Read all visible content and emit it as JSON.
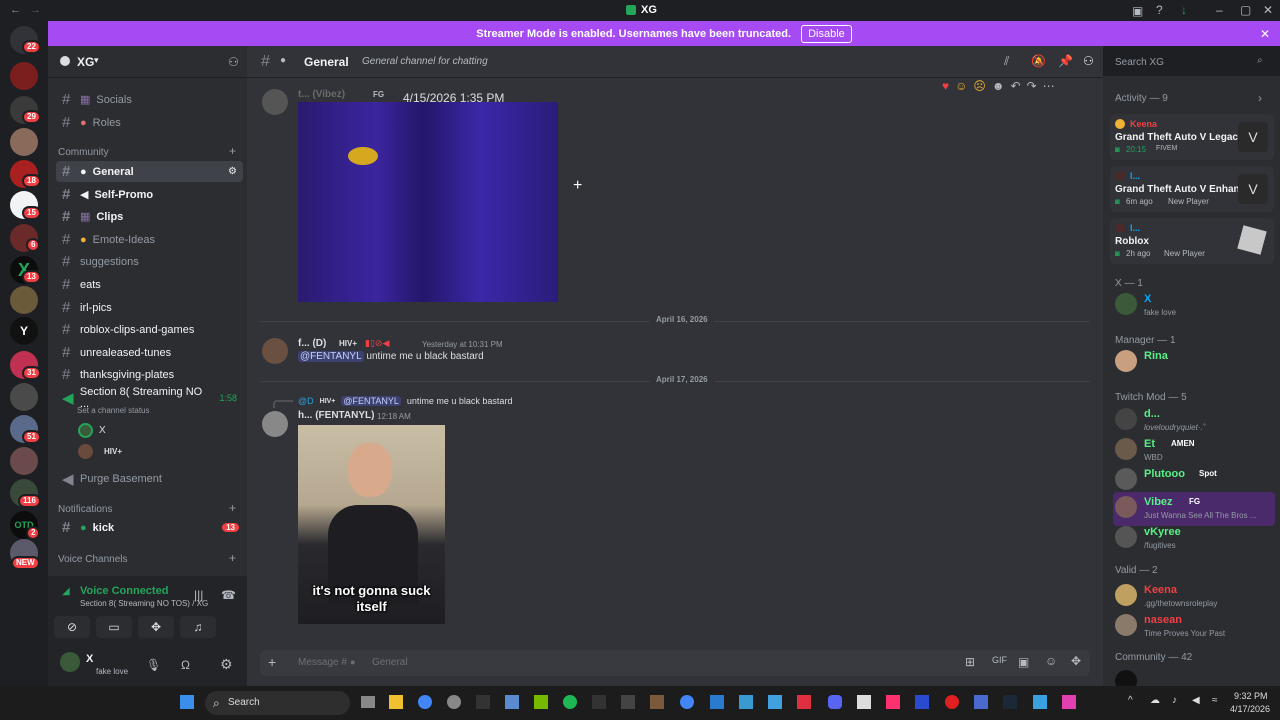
{
  "window": {
    "title": "XG"
  },
  "banner": {
    "text": "Streamer Mode is enabled. Usernames have been truncated.",
    "disable": "Disable"
  },
  "server_badges": [
    "22",
    "29",
    "18",
    "15",
    "6",
    "13",
    "31",
    "51",
    "116",
    "2"
  ],
  "new_badge": "NEW",
  "server": {
    "name": "XG"
  },
  "channels": {
    "c1": "Socials",
    "c2": "Roles",
    "community_cat": "Community",
    "general": "General",
    "selfpromo": "Self-Promo",
    "clips": "Clips",
    "emote": "Emote-Ideas",
    "suggestions": "suggestions",
    "eats": "eats",
    "irl": "irl-pics",
    "roblox": "roblox-clips-and-games",
    "unreleased": "unrealeased-tunes",
    "thanksgiving": "thanksgiving-plates",
    "voice": "Section 8( Streaming NO ...",
    "voice_time": "1:58",
    "voice_status": "Set a channel status",
    "vu1": "X",
    "vu2": "HIV+",
    "purge": "Purge Basement",
    "notif_cat": "Notifications",
    "kick": "kick",
    "kick_badge": "13",
    "vc_cat": "Voice Channels"
  },
  "voice_panel": {
    "title": "Voice Connected",
    "sub": "Section 8( Streaming NO TOS) / XG"
  },
  "user_panel": {
    "name": "X",
    "status": "fake love"
  },
  "header": {
    "channel": "General",
    "topic": "General channel for chatting",
    "search": "Search XG"
  },
  "messages": {
    "m1_user": "t... (Vibez)",
    "m1_tag": "FG",
    "m1_time": "4/15/2026 1:35 PM",
    "date1": "April 16, 2026",
    "m2_user": "f... (D)",
    "m2_tag": "HIV+",
    "m2_time": "Yesterday at 10:31 PM",
    "m2_mention": "@FENTANYL",
    "m2_text": "untime me u black bastard",
    "date2": "April 17, 2026",
    "m3_reply_user": "@D",
    "m3_reply_tag": "HIV+",
    "m3_reply_mention": "@FENTANYL",
    "m3_reply_text": "untime me u black bastard",
    "m3_user": "h... (FENTANYL)",
    "m3_time": "12:18 AM",
    "m3_caption": "it's not gonna suck itself"
  },
  "composer": {
    "placeholder": "Message #",
    "channel": "General"
  },
  "activity": {
    "head": "Activity — 9",
    "a1_user": "Keena",
    "a1_game": "Grand Theft Auto V Legacy",
    "a1_time": "20:15",
    "a1_server": "FIVEM",
    "a2_user": "I...",
    "a2_game": "Grand Theft Auto V Enhan...",
    "a2_time": "6m ago",
    "a2_sub": "New Player",
    "a3_user": "I...",
    "a3_game": "Roblox",
    "a3_time": "2h ago",
    "a3_sub": "New Player"
  },
  "members": {
    "g1": "X — 1",
    "u1": "X",
    "u1s": "fake love",
    "g2": "Manager — 1",
    "u2": "Rina",
    "g3": "Twitch Mod — 5",
    "u3": "d...",
    "u3s": "loveloudryquiet·.˚",
    "u4": "Et",
    "u4tag": "AMEN",
    "u4s": "WBD",
    "u5": "Plutooo",
    "u5tag": "Spot",
    "u6": "Vibez",
    "u6tag": "FG",
    "u6s": "Just Wanna See All The Bros ...",
    "u7": "vKyree",
    "u7s": "/fugitives",
    "g4": "Valid — 2",
    "u8": "Keena",
    "u8s": ".gg/thetownsroleplay",
    "u9": "nasean",
    "u9s": "Time Proves Your Past",
    "g5": "Community — 42"
  },
  "taskbar": {
    "search": "Search",
    "time": "9:32 PM",
    "date": "4/17/2026"
  },
  "colors": {
    "accent": "#a64bf4",
    "green": "#23a55a",
    "mention": "#c9cdfb"
  }
}
